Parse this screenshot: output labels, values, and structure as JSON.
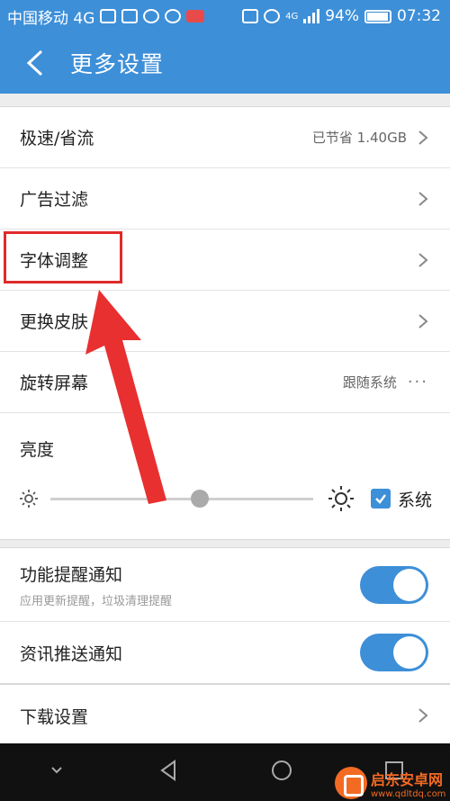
{
  "status_bar": {
    "carrier": "中国移动 4G",
    "network": "4G",
    "battery": "94%",
    "time": "07:32"
  },
  "header": {
    "title": "更多设置",
    "back_icon": "chevron-left-icon"
  },
  "settings": {
    "speed": {
      "label": "极速/省流",
      "value": "已节省 1.40GB"
    },
    "ad_filter": {
      "label": "广告过滤"
    },
    "font_size": {
      "label": "字体调整"
    },
    "skin": {
      "label": "更换皮肤"
    },
    "rotation": {
      "label": "旋转屏幕",
      "value": "跟随系统",
      "more": "···"
    },
    "brightness": {
      "label": "亮度",
      "level": 0.57,
      "system_label": "系统",
      "system_checked": true
    },
    "feature_notify": {
      "label": "功能提醒通知",
      "sub": "应用更新提醒，垃圾清理提醒",
      "enabled": true
    },
    "news_notify": {
      "label": "资讯推送通知",
      "enabled": true
    },
    "download": {
      "label": "下载设置"
    }
  },
  "watermark": {
    "title": "启东安卓网",
    "url": "www.qdltdq.com"
  },
  "colors": {
    "accent": "#3d8fd8",
    "highlight": "#e02a2a"
  }
}
